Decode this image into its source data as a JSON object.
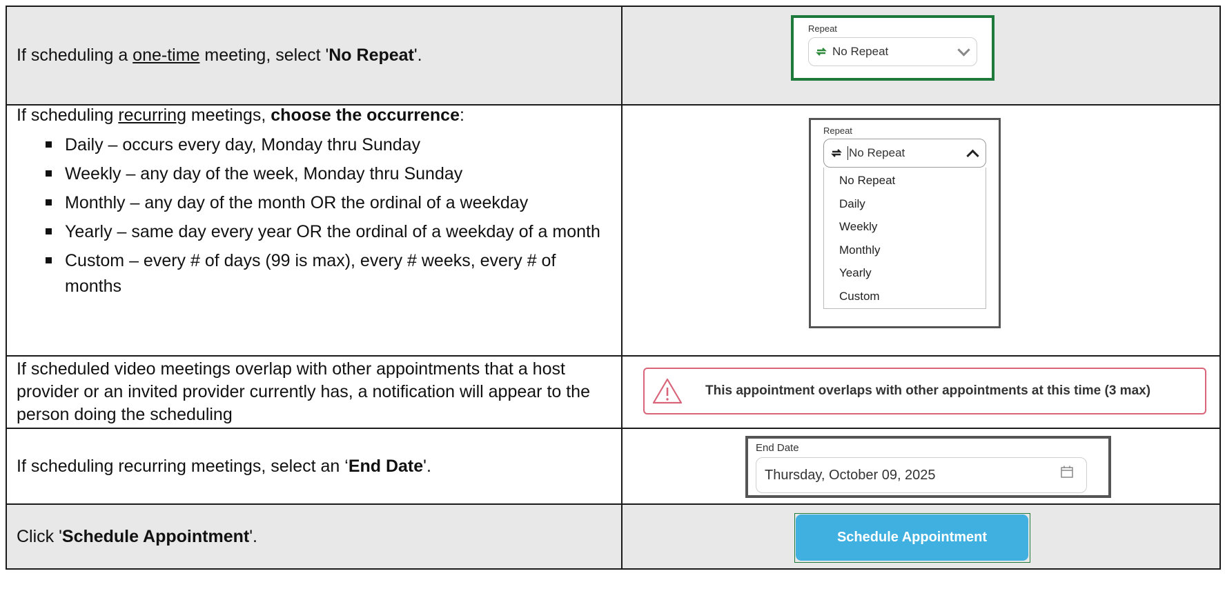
{
  "rows": [
    {
      "instruction": {
        "pre": "If scheduling a ",
        "underline": "one-time",
        "mid": " meeting, select '",
        "bold": "No Repeat",
        "post": "'."
      },
      "widget": {
        "label": "Repeat",
        "value": "No Repeat"
      }
    },
    {
      "instruction": {
        "pre": "If scheduling ",
        "underline": "recurring",
        "mid": " meetings, ",
        "bold": "choose the occurrence",
        "post": ":"
      },
      "bullets": [
        "Daily – occurs every day, Monday thru Sunday",
        "Weekly – any day of the week, Monday thru Sunday",
        "Monthly – any day of the month OR the ordinal of a weekday",
        "Yearly – same day every year OR the ordinal of a weekday of a month",
        "Custom – every # of days (99 is max), every # weeks, every # of months"
      ],
      "widget": {
        "label": "Repeat",
        "value": "No Repeat",
        "options": [
          "No Repeat",
          "Daily",
          "Weekly",
          "Monthly",
          "Yearly",
          "Custom"
        ]
      }
    },
    {
      "instruction": {
        "text": "If scheduled video meetings overlap with other appointments that a host provider or an invited provider currently has, a notification will appear to the person doing the scheduling"
      },
      "widget": {
        "message": "This appointment overlaps with other appointments at this time (3 max)"
      }
    },
    {
      "instruction": {
        "pre": "If scheduling recurring meetings, select an ‘",
        "bold": "End Date",
        "post": "'."
      },
      "widget": {
        "label": "End Date",
        "value": "Thursday, October 09, 2025"
      }
    },
    {
      "instruction": {
        "pre": "Click '",
        "bold": "Schedule Appointment",
        "post": "'."
      },
      "widget": {
        "button": "Schedule Appointment"
      }
    }
  ],
  "colors": {
    "highlight_border": "#1e7a3a",
    "alert_border": "#d9647a",
    "button_bg": "#3fb0e0",
    "row_grey": "#e8e8e8"
  }
}
